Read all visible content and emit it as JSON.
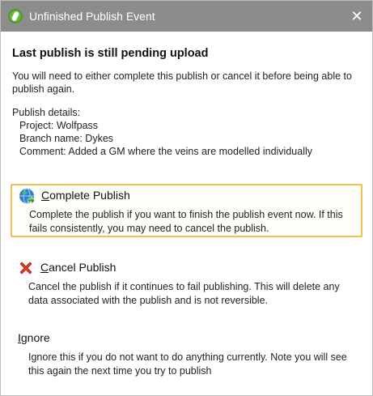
{
  "window": {
    "title": "Unfinished Publish Event",
    "close_glyph": "✕",
    "app_icon": "leapfrog-app-icon"
  },
  "heading": "Last publish is still pending upload",
  "description": "You will need to either complete this publish or cancel it before being able to publish again.",
  "details": {
    "label": "Publish details:",
    "project": "Project: Wolfpass",
    "branch": "Branch name: Dykes",
    "comment": "Comment: Added a GM where the veins are modelled individually"
  },
  "options": [
    {
      "label_first": "C",
      "label_rest": "omplete Publish",
      "description": "Complete the publish if you want to finish the publish event now. If this fails consistently, you may need to cancel the publish.",
      "icon": "globe-icon",
      "selected": true
    },
    {
      "label_first": "C",
      "label_rest": "ancel Publish",
      "description": "Cancel the publish if it continues to fail publishing. This will delete any data associated with the publish and is not reversible.",
      "icon": "cancel-x-icon",
      "selected": false
    },
    {
      "label_first": "I",
      "label_rest": "gnore",
      "description": "Ignore this if you do not want to do anything currently. Note you will see this again the next time you try to publish",
      "icon": "",
      "selected": false
    }
  ],
  "colors": {
    "titlebar": "#8c8c8c",
    "selected_border": "#f3bf4e",
    "cancel_red": "#e0392f",
    "globe_blue": "#2f7fd1"
  }
}
